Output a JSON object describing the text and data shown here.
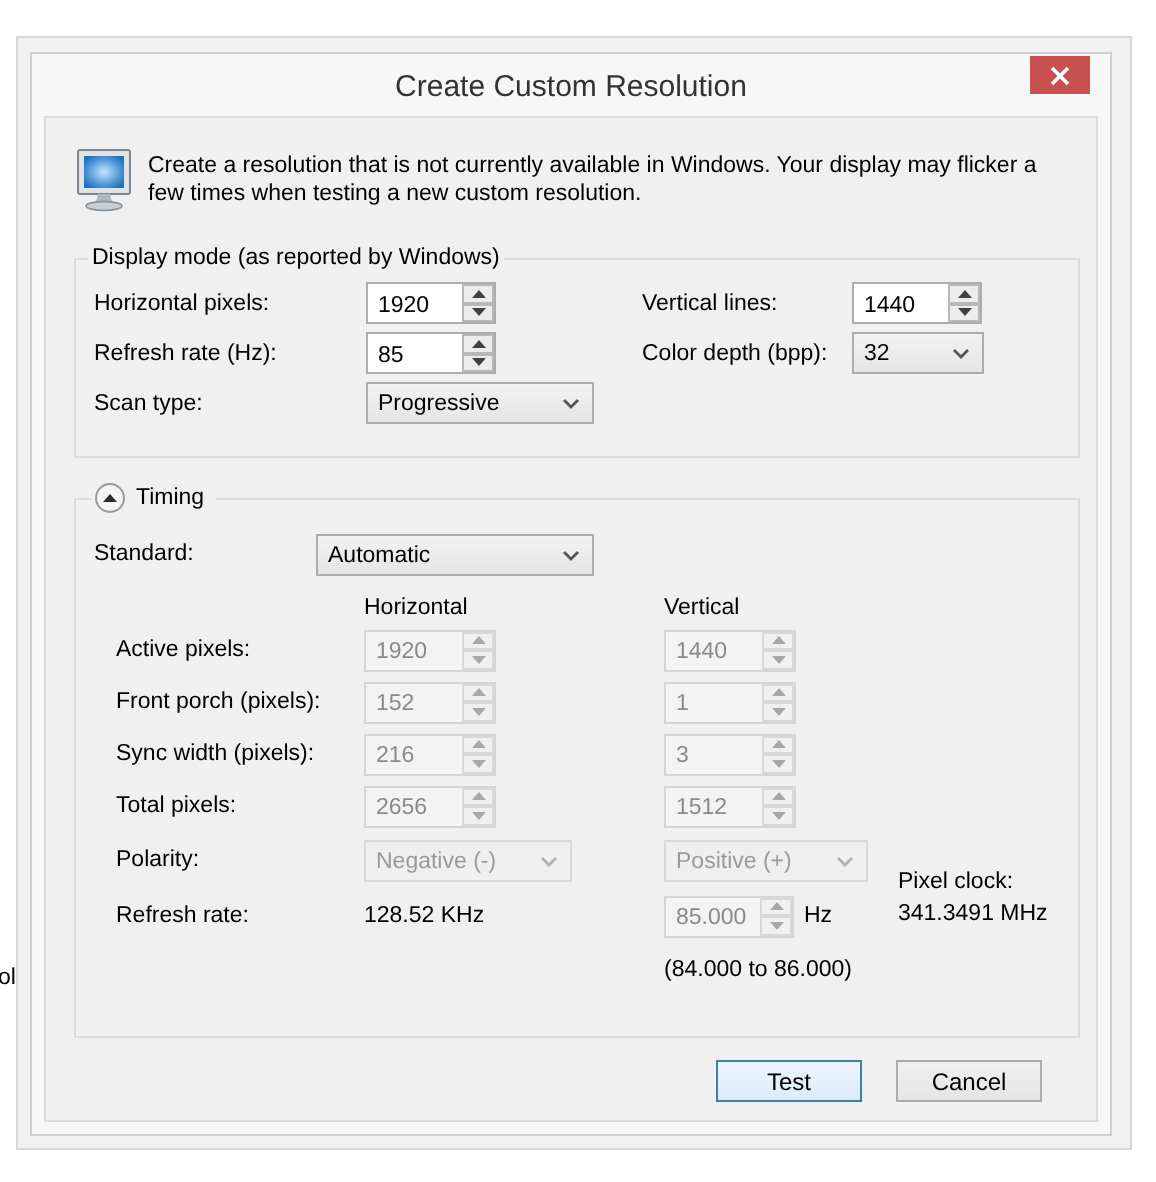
{
  "background": {
    "text": "ol"
  },
  "window": {
    "title": "Create Custom Resolution"
  },
  "intro": {
    "text": "Create a resolution that is not currently available in Windows. Your display may flicker a few times when testing a new custom resolution."
  },
  "display_mode": {
    "title": "Display mode (as reported by Windows)",
    "fields": [
      {
        "label": "Horizontal pixels:",
        "kind": "spin",
        "value": "1920",
        "disabled": false
      },
      {
        "label": "Vertical lines:",
        "kind": "spin",
        "value": "1440",
        "disabled": false
      },
      {
        "label": "Refresh rate (Hz):",
        "kind": "spin",
        "value": "85",
        "disabled": false
      },
      {
        "label": "Color depth (bpp):",
        "kind": "combo",
        "value": "32",
        "disabled": false
      },
      {
        "label": "Scan type:",
        "kind": "combo",
        "value": "Progressive",
        "disabled": false
      }
    ]
  },
  "timing": {
    "title": "Timing",
    "expanded": true,
    "standard": {
      "label": "Standard:",
      "value": "Automatic",
      "disabled": false
    },
    "columns": [
      "Horizontal",
      "Vertical"
    ],
    "rows": [
      {
        "label": "Active pixels:",
        "cells": [
          {
            "kind": "spin",
            "value": "1920",
            "disabled": true
          },
          {
            "kind": "spin",
            "value": "1440",
            "disabled": true
          }
        ]
      },
      {
        "label": "Front porch (pixels):",
        "cells": [
          {
            "kind": "spin",
            "value": "152",
            "disabled": true
          },
          {
            "kind": "spin",
            "value": "1",
            "disabled": true
          }
        ]
      },
      {
        "label": "Sync width (pixels):",
        "cells": [
          {
            "kind": "spin",
            "value": "216",
            "disabled": true
          },
          {
            "kind": "spin",
            "value": "3",
            "disabled": true
          }
        ]
      },
      {
        "label": "Total pixels:",
        "cells": [
          {
            "kind": "spin",
            "value": "2656",
            "disabled": true
          },
          {
            "kind": "spin",
            "value": "1512",
            "disabled": true
          }
        ]
      },
      {
        "label": "Polarity:",
        "cells": [
          {
            "kind": "combo",
            "value": "Negative (-)",
            "disabled": true
          },
          {
            "kind": "combo",
            "value": "Positive (+)",
            "disabled": true
          }
        ]
      },
      {
        "label": "Refresh rate:",
        "cells": [
          {
            "kind": "text",
            "value": "128.52 KHz"
          },
          {
            "kind": "spin",
            "value": "85.000",
            "disabled": true,
            "unit": "Hz"
          }
        ]
      }
    ],
    "pixel_clock": {
      "label": "Pixel clock:",
      "value": "341.3491 MHz"
    },
    "range": "(84.000 to 86.000)"
  },
  "buttons": [
    {
      "label": "Test",
      "default": true
    },
    {
      "label": "Cancel",
      "default": false
    }
  ]
}
